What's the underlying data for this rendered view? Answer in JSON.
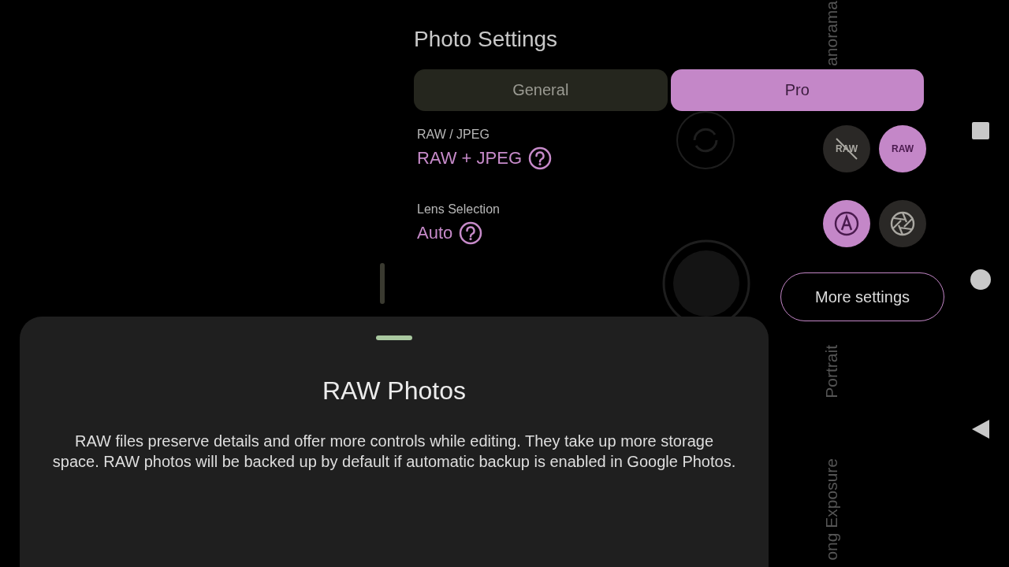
{
  "camera_modes": [
    {
      "label": "anorama"
    },
    {
      "label": "Portrait"
    },
    {
      "label": "ong Exposure"
    }
  ],
  "settings": {
    "title": "Photo Settings",
    "tabs": [
      {
        "label": "General",
        "selected": false
      },
      {
        "label": "Pro",
        "selected": true
      }
    ],
    "rows": [
      {
        "label": "RAW / JPEG",
        "value": "RAW + JPEG",
        "options": [
          {
            "kind": "raw_off",
            "label": "RAW",
            "selected": false
          },
          {
            "kind": "raw",
            "label": "RAW",
            "selected": true
          }
        ]
      },
      {
        "label": "Lens Selection",
        "value": "Auto",
        "options": [
          {
            "kind": "auto",
            "selected": true
          },
          {
            "kind": "aperture",
            "selected": false
          }
        ]
      }
    ],
    "more_button": "More settings"
  },
  "sheet": {
    "title": "RAW Photos",
    "body": "RAW files preserve details and offer more controls while editing. They take up more storage space. RAW photos will be backed up by default if automatic backup is enabled in Google Photos."
  }
}
